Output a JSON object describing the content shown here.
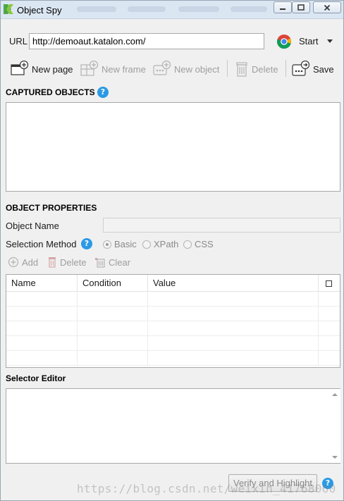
{
  "window": {
    "title": "Object Spy"
  },
  "url_bar": {
    "label": "URL",
    "value": "http://demoaut.katalon.com/",
    "browser_icon": "chrome-icon",
    "start_label": "Start"
  },
  "toolbar": {
    "new_page": "New page",
    "new_frame": "New frame",
    "new_object": "New object",
    "delete": "Delete",
    "save": "Save"
  },
  "captured_objects": {
    "title": "CAPTURED OBJECTS"
  },
  "object_properties": {
    "title": "OBJECT PROPERTIES",
    "object_name_label": "Object Name",
    "object_name_value": "",
    "selection_method_label": "Selection Method",
    "methods": [
      "Basic",
      "XPath",
      "CSS"
    ],
    "selected_method": "Basic",
    "add": "Add",
    "delete": "Delete",
    "clear": "Clear",
    "table": {
      "columns": [
        "Name",
        "Condition",
        "Value"
      ],
      "rows": []
    }
  },
  "selector_editor": {
    "title": "Selector Editor",
    "value": ""
  },
  "footer": {
    "verify_button": "Verify and Highlight"
  },
  "watermark": "https://blog.csdn.net/weixin_41768060",
  "colors": {
    "help_icon": "#2a9ae6",
    "disabled_text": "#9e9e9e",
    "window_bg": "#f0f0f0"
  }
}
